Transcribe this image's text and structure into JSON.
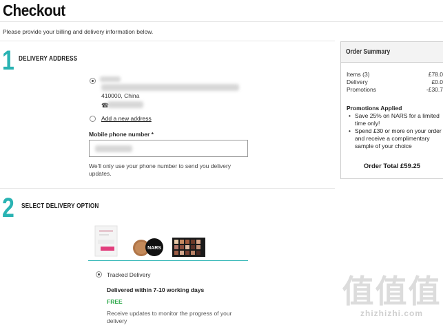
{
  "page": {
    "title": "Checkout",
    "intro": "Please provide your billing and delivery information below."
  },
  "delivery_address": {
    "step_number": "1",
    "title": "DELIVERY ADDRESS",
    "address_postcode": "410000, China",
    "add_new_address": "Add a new address",
    "phone_label": "Mobile phone number *",
    "phone_value": "",
    "phone_helper": "We'll only use your phone number to send you delivery updates."
  },
  "delivery_option": {
    "step_number": "2",
    "title": "SELECT DELIVERY OPTION",
    "product_brand": "NARS",
    "option_label": "Tracked Delivery",
    "option_title": "Delivered within 7-10 working days",
    "option_price": "FREE",
    "option_desc": "Receive updates to monitor the progress of your delivery"
  },
  "order_summary": {
    "title": "Order Summary",
    "rows": [
      {
        "label": "Items (3)",
        "value": "£78.0"
      },
      {
        "label": "Delivery",
        "value": "£0.0"
      },
      {
        "label": "Promotions",
        "value": "-£30.7"
      }
    ],
    "promotions_title": "Promotions Applied",
    "promotions": [
      "Save 25% on NARS for a limited time only!",
      "Spend £30 or more on your order and receive a complimentary sample of your choice"
    ],
    "total": "Order Total £59.25"
  },
  "watermark": {
    "glyphs": "值值值",
    "text": "zhizhizhi.com"
  },
  "colors": {
    "accent": "#2ab3b3",
    "free": "#2aa748"
  }
}
